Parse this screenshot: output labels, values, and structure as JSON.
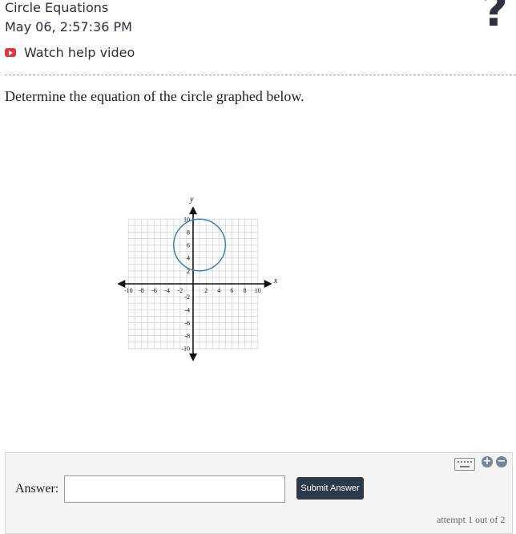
{
  "header": {
    "title": "Circle Equations",
    "timestamp": "May 06, 2:57:36 PM",
    "help_label": "Watch help video",
    "help_button": "?"
  },
  "question": {
    "prompt": "Determine the equation of the circle graphed below."
  },
  "graph": {
    "x_label": "x",
    "y_label": "y",
    "x_range": [
      -10,
      10
    ],
    "y_range": [
      -10,
      10
    ],
    "x_ticks": [
      -10,
      -8,
      -6,
      -4,
      -2,
      2,
      4,
      6,
      8,
      10
    ],
    "y_ticks": [
      10,
      8,
      6,
      4,
      2,
      -2,
      -4,
      -6,
      -8,
      -10
    ],
    "grid": true,
    "circle": {
      "center": [
        1,
        6
      ],
      "radius": 4,
      "color": "#3b7fb6"
    }
  },
  "answer": {
    "label": "Answer:",
    "value": "",
    "submit_label": "Submit Answer",
    "attempt_text": "attempt 1 out of 2",
    "zoom_in": "+",
    "zoom_out": "−"
  }
}
